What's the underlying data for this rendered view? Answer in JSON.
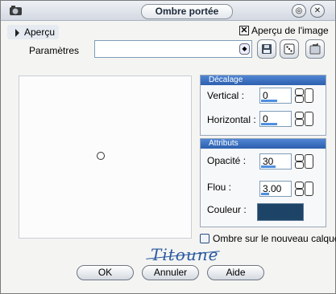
{
  "window": {
    "title": "Ombre portée",
    "minimize_glyph": "◎",
    "close_glyph": "✕"
  },
  "preview_tab": {
    "label": "Aperçu"
  },
  "image_preview": {
    "label": "Aperçu de l'image",
    "checked": true,
    "mark": "✕"
  },
  "presets": {
    "label": "Paramètres",
    "value": ""
  },
  "icons": [
    "app-icon",
    "save-preset-icon",
    "dice-icon",
    "reset-icon",
    "spin-arrows-icon"
  ],
  "decalage": {
    "header": "Décalage",
    "vertical": {
      "label": "Vertical :",
      "value": "0",
      "fill": 0.55
    },
    "horizontal": {
      "label": "Horizontal :",
      "value": "0",
      "fill": 0.55
    }
  },
  "attributs": {
    "header": "Attributs",
    "opacite": {
      "label": "Opacité :",
      "value": "30",
      "fill": 0.3
    },
    "flou": {
      "label": "Flou :",
      "value": "3.00",
      "fill": 0.2
    },
    "couleur": {
      "label": "Couleur :",
      "color": "#1d4466"
    }
  },
  "new_layer": {
    "label": "Ombre sur le nouveau calque",
    "checked": false
  },
  "signature": "Titoune",
  "buttons": {
    "ok": "OK",
    "cancel": "Annuler",
    "help": "Aide"
  }
}
